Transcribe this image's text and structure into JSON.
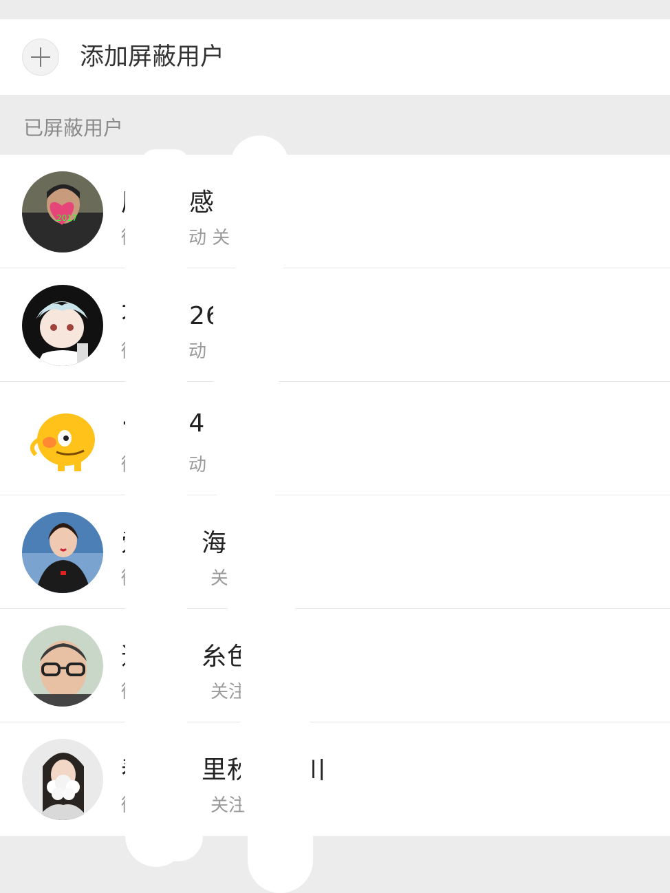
{
  "add_row": {
    "label": "添加屏蔽用户",
    "icon": "plus-icon"
  },
  "section": {
    "title": "已屏蔽用户"
  },
  "users": [
    {
      "name": "厉 …… 感",
      "name_left": "厉",
      "name_right": "感",
      "subtitle_left": "微",
      "subtitle_right": "动 关",
      "avatar": "avatar-man-2017"
    },
    {
      "name": "…26",
      "name_left": "不",
      "name_right": "26",
      "subtitle_left": "微",
      "subtitle_right": "动",
      "avatar": "avatar-anime-boy"
    },
    {
      "name": "…54",
      "name_left": "·",
      "name_right": "54",
      "subtitle_left": "微",
      "subtitle_right": "动 :",
      "avatar": "avatar-yellow-dino"
    },
    {
      "name": "爱 …… 海",
      "name_left": "爱",
      "name_right": "海",
      "subtitle_left": "微",
      "subtitle_right": "关",
      "avatar": "avatar-woman"
    },
    {
      "name": "道 …… 糸色",
      "name_left": "道",
      "name_right": "糸色",
      "subtitle_left": "微",
      "subtitle_right": "关注",
      "avatar": "avatar-man-glasses"
    },
    {
      "name": "春 …… 里秋 …… 川",
      "name_left": "春",
      "name_right": "里秋",
      "name_far": "川",
      "subtitle_left": "微",
      "subtitle_right": "关注",
      "avatar": "avatar-girl-flowers"
    }
  ],
  "colors": {
    "background": "#ececec",
    "row": "#ffffff",
    "divider": "#e6e6e6",
    "text_primary": "#222222",
    "text_secondary": "#9a9a9a"
  }
}
